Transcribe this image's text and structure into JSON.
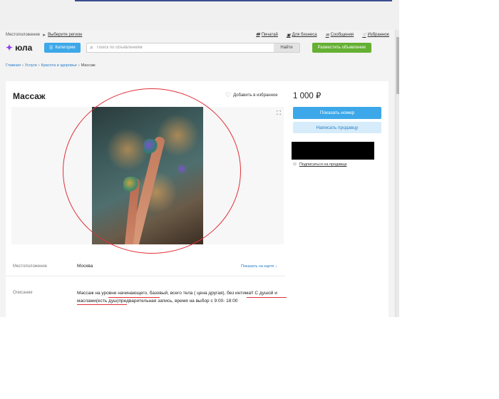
{
  "utilbar": {
    "location_label": "Местоположение",
    "location_link": "Выберите регион",
    "links": [
      {
        "icon": "print-icon",
        "label": "Печатай"
      },
      {
        "icon": "briefcase-icon",
        "label": "Для бизнеса"
      },
      {
        "icon": "message-icon",
        "label": "Сообщения"
      },
      {
        "icon": "heart-icon",
        "label": "Избранное"
      }
    ]
  },
  "header": {
    "logo": "юла",
    "categories_label": "Категории",
    "search_placeholder": "Поиск по объявлениям",
    "search_button": "Найти",
    "post_button": "Разместить объявление"
  },
  "breadcrumbs": [
    "Главная",
    "Услуги",
    "Красота и здоровье"
  ],
  "breadcrumb_current": "Массаж",
  "listing": {
    "title": "Массаж",
    "favorite_label": "Добавить в избранное",
    "price": "1 000 ₽",
    "show_phone": "Показать номер",
    "write_seller": "Написать продавцу",
    "subscribe": "Подписаться на продавца",
    "location_label": "Местоположение",
    "location_value": "Москва",
    "map_link": "Показать на карте ↓",
    "description_label": "Описание",
    "description": "Массаж на уровне начинающего, базовый, всего тела ( цена другая), без интима!! С душой и маслами(есть душ)предварительная запись, время на выбор с 9:00- 18:00"
  },
  "colors": {
    "accent_blue": "#3da8e9",
    "green": "#65b033",
    "annotation_red": "#e0303a"
  }
}
